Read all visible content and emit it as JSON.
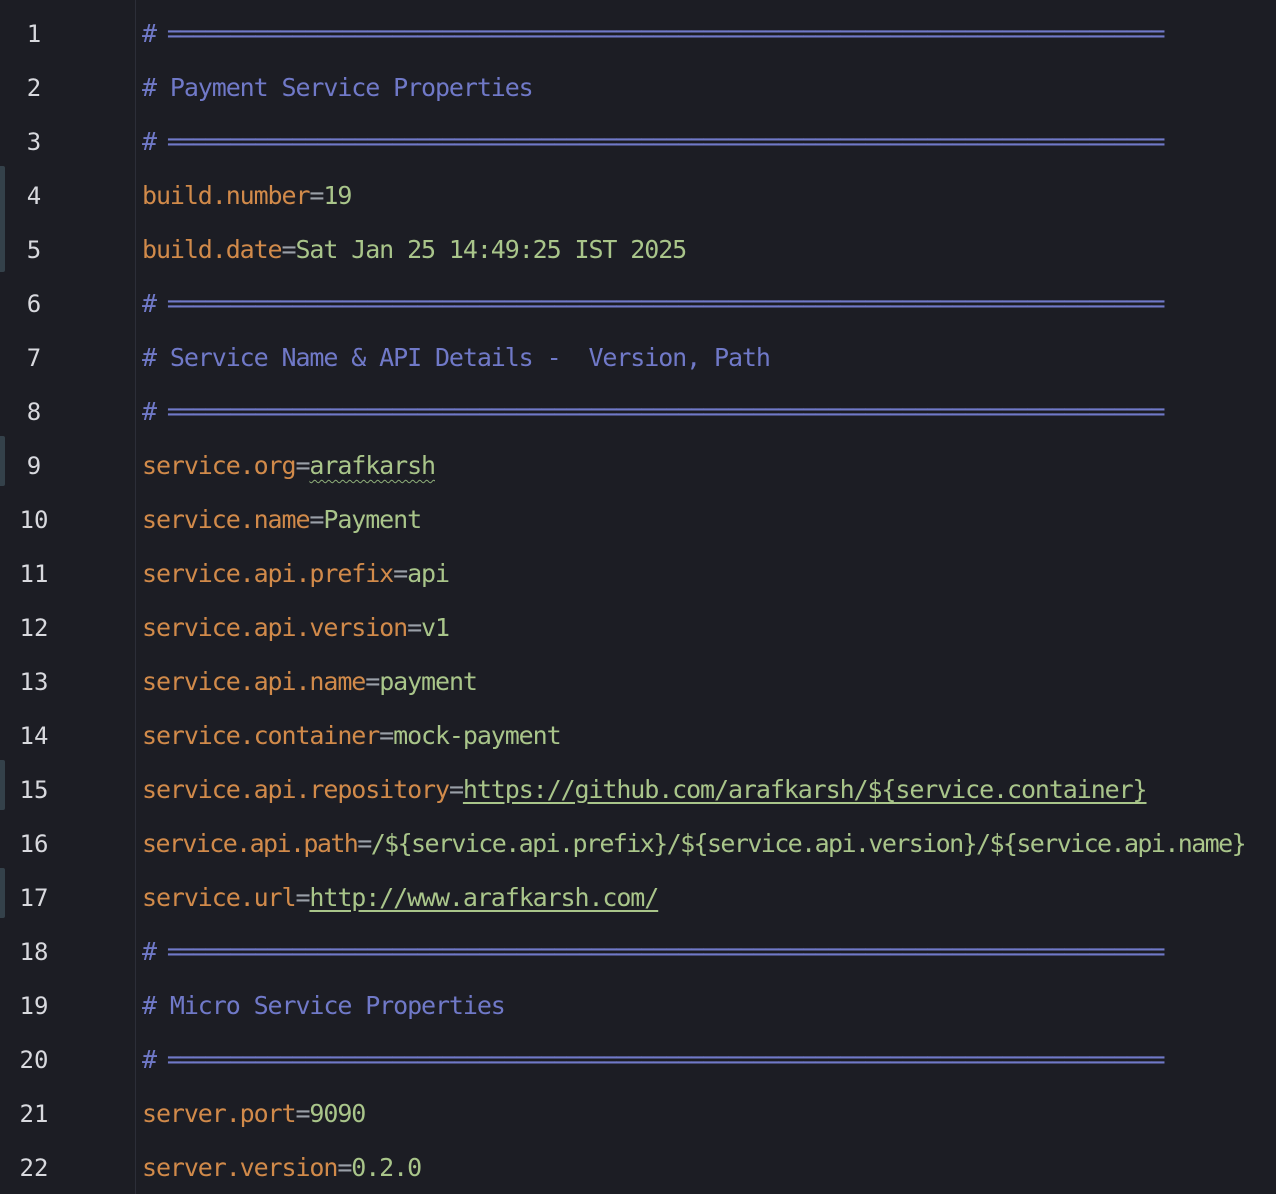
{
  "editor": {
    "lines": [
      {
        "number": "1",
        "kind": "comment",
        "text": "# ================================================================================"
      },
      {
        "number": "2",
        "kind": "comment",
        "text": "# Payment Service Properties"
      },
      {
        "number": "3",
        "kind": "comment",
        "text": "# ================================================================================"
      },
      {
        "number": "4",
        "kind": "prop",
        "key": "build.number",
        "value": "19"
      },
      {
        "number": "5",
        "kind": "prop",
        "key": "build.date",
        "value": "Sat Jan 25 14:49:25 IST 2025"
      },
      {
        "number": "6",
        "kind": "comment",
        "text": "# ================================================================================"
      },
      {
        "number": "7",
        "kind": "comment",
        "text": "# Service Name & API Details -  Version, Path"
      },
      {
        "number": "8",
        "kind": "comment",
        "text": "# ================================================================================"
      },
      {
        "number": "9",
        "kind": "prop",
        "key": "service.org",
        "value": "arafkarsh"
      },
      {
        "number": "10",
        "kind": "prop",
        "key": "service.name",
        "value": "Payment"
      },
      {
        "number": "11",
        "kind": "prop",
        "key": "service.api.prefix",
        "value": "api"
      },
      {
        "number": "12",
        "kind": "prop",
        "key": "service.api.version",
        "value": "v1"
      },
      {
        "number": "13",
        "kind": "prop",
        "key": "service.api.name",
        "value": "payment"
      },
      {
        "number": "14",
        "kind": "prop",
        "key": "service.container",
        "value": "mock-payment"
      },
      {
        "number": "15",
        "kind": "prop",
        "key": "service.api.repository",
        "value": "https://github.com/arafkarsh/${service.container}"
      },
      {
        "number": "16",
        "kind": "prop",
        "key": "service.api.path",
        "value": "/${service.api.prefix}/${service.api.version}/${service.api.name}"
      },
      {
        "number": "17",
        "kind": "prop",
        "key": "service.url",
        "value": "http://www.arafkarsh.com/"
      },
      {
        "number": "18",
        "kind": "comment",
        "text": "# ================================================================================"
      },
      {
        "number": "19",
        "kind": "comment",
        "text": "# Micro Service Properties"
      },
      {
        "number": "20",
        "kind": "comment",
        "text": "# ================================================================================"
      },
      {
        "number": "21",
        "kind": "prop",
        "key": "server.port",
        "value": "9090"
      },
      {
        "number": "22",
        "kind": "prop",
        "key": "server.version",
        "value": "0.2.0"
      }
    ],
    "equals": "=",
    "colors": {
      "background": "#1c1d24",
      "comment": "#7079c8",
      "key": "#d18a4a",
      "value": "#a9c58a",
      "line_number": "#d8d9de"
    }
  }
}
